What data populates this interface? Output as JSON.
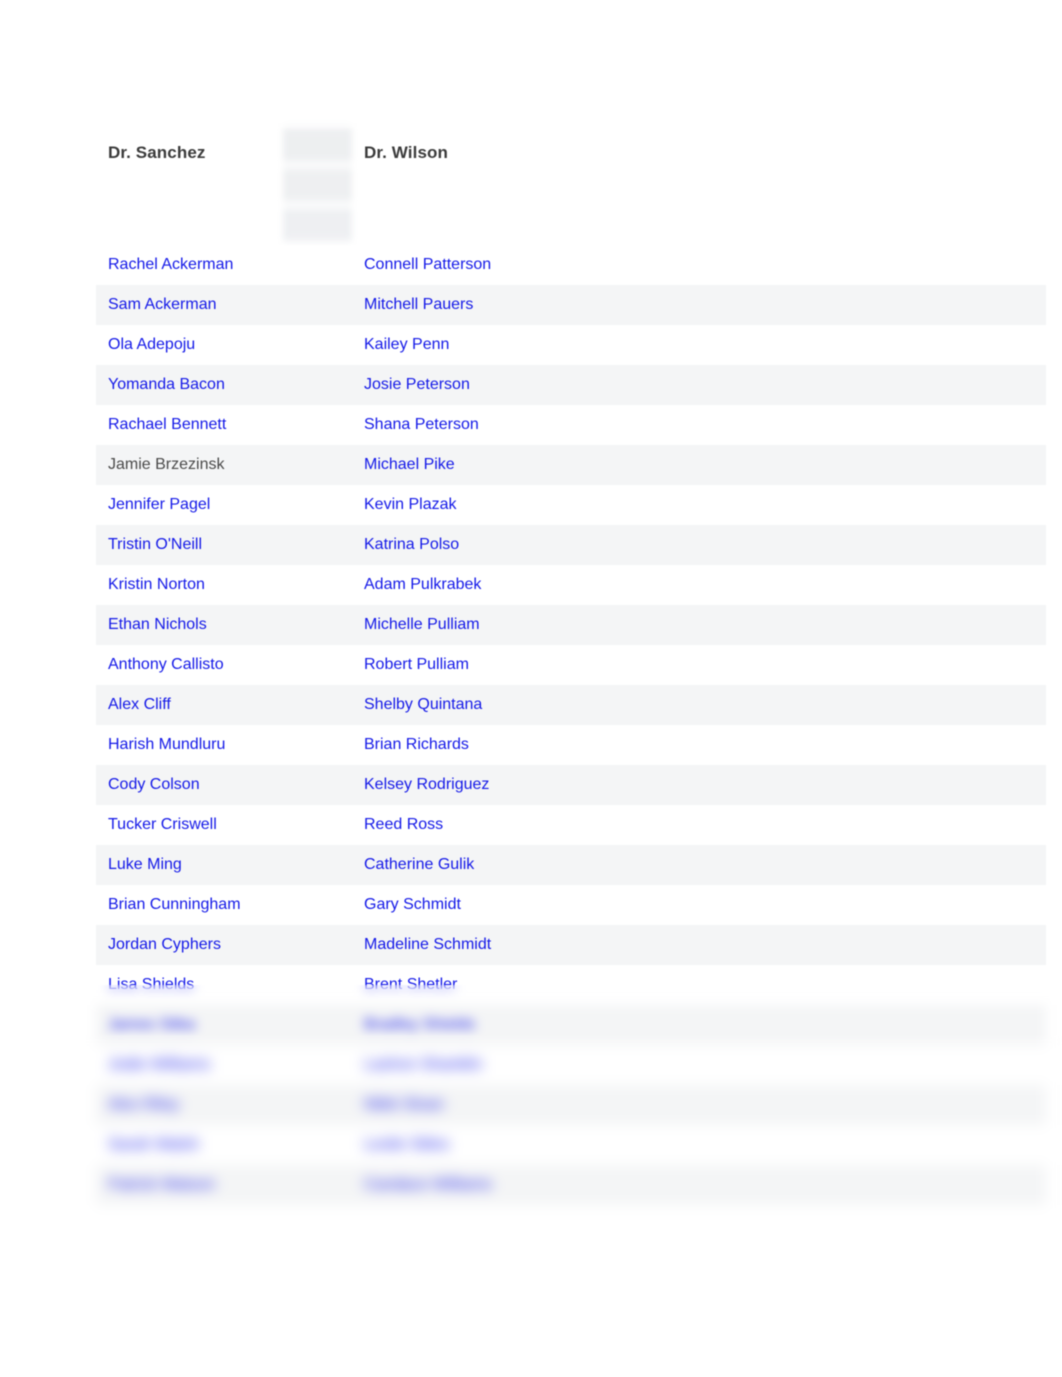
{
  "page": {
    "background_color": "#ffffff",
    "link_color": "#1419e8",
    "visited_link_color": "#4a4a4a",
    "header_text_color": "#3b3b3b",
    "stripe_color": "#f4f5f6"
  },
  "table": {
    "columns": [
      {
        "id": "col-sanchez",
        "header": "Dr. Sanchez"
      },
      {
        "id": "col-gap",
        "header": ""
      },
      {
        "id": "col-wilson",
        "header": "Dr. Wilson"
      },
      {
        "id": "col-rest",
        "header": ""
      }
    ],
    "rows": [
      {
        "sanchez": "Rachel Ackerman",
        "sanchez_state": "link",
        "wilson": "Connell Patterson",
        "wilson_state": "link",
        "blurred": false
      },
      {
        "sanchez": "Sam Ackerman",
        "sanchez_state": "link",
        "wilson": "Mitchell Pauers",
        "wilson_state": "link",
        "blurred": false
      },
      {
        "sanchez": "Ola Adepoju",
        "sanchez_state": "link",
        "wilson": "Kailey Penn",
        "wilson_state": "link",
        "blurred": false
      },
      {
        "sanchez": "Yomanda Bacon",
        "sanchez_state": "link",
        "wilson": "Josie Peterson",
        "wilson_state": "link",
        "blurred": false
      },
      {
        "sanchez": "Rachael Bennett",
        "sanchez_state": "link",
        "wilson": "Shana Peterson",
        "wilson_state": "link",
        "blurred": false
      },
      {
        "sanchez": "Jamie Brzezinsk",
        "sanchez_state": "visited",
        "wilson": "Michael Pike",
        "wilson_state": "link",
        "blurred": false
      },
      {
        "sanchez": "Jennifer Pagel",
        "sanchez_state": "link",
        "wilson": "Kevin Plazak",
        "wilson_state": "link",
        "blurred": false
      },
      {
        "sanchez": "Tristin O'Neill",
        "sanchez_state": "link",
        "wilson": "Katrina Polso",
        "wilson_state": "link",
        "blurred": false
      },
      {
        "sanchez": "Kristin Norton",
        "sanchez_state": "link",
        "wilson": "Adam Pulkrabek",
        "wilson_state": "link",
        "blurred": false
      },
      {
        "sanchez": "Ethan Nichols",
        "sanchez_state": "link",
        "wilson": "Michelle Pulliam",
        "wilson_state": "link",
        "blurred": false
      },
      {
        "sanchez": "Anthony Callisto",
        "sanchez_state": "link",
        "wilson": "Robert Pulliam",
        "wilson_state": "link",
        "blurred": false
      },
      {
        "sanchez": "Alex Cliff",
        "sanchez_state": "link",
        "wilson": "Shelby Quintana",
        "wilson_state": "link",
        "blurred": false
      },
      {
        "sanchez": "Harish Mundluru",
        "sanchez_state": "link",
        "wilson": "Brian Richards",
        "wilson_state": "link",
        "blurred": false
      },
      {
        "sanchez": "Cody Colson",
        "sanchez_state": "link",
        "wilson": "Kelsey Rodriguez",
        "wilson_state": "link",
        "blurred": false
      },
      {
        "sanchez": "Tucker Criswell",
        "sanchez_state": "link",
        "wilson": "Reed Ross",
        "wilson_state": "link",
        "blurred": false
      },
      {
        "sanchez": "Luke Ming",
        "sanchez_state": "link",
        "wilson": "Catherine Gulik",
        "wilson_state": "link",
        "blurred": false
      },
      {
        "sanchez": "Brian Cunningham",
        "sanchez_state": "link",
        "wilson": "Gary Schmidt",
        "wilson_state": "link",
        "blurred": false
      },
      {
        "sanchez": "Jordan Cyphers",
        "sanchez_state": "link",
        "wilson": "Madeline Schmidt",
        "wilson_state": "link",
        "blurred": false
      },
      {
        "sanchez": "Lisa Shields",
        "sanchez_state": "link",
        "wilson": "Brent Shetler",
        "wilson_state": "link",
        "blurred": true
      },
      {
        "sanchez": "James Sitka",
        "sanchez_state": "link",
        "wilson": "Bradley Shields",
        "wilson_state": "link",
        "blurred": true
      },
      {
        "sanchez": "Jodie Williams",
        "sanchez_state": "link",
        "wilson": "Lashon Shanklin",
        "wilson_state": "link",
        "blurred": true
      },
      {
        "sanchez": "Alex Riley",
        "sanchez_state": "link",
        "wilson": "Nikki Sloan",
        "wilson_state": "link",
        "blurred": true
      },
      {
        "sanchez": "Sarah Walsh",
        "sanchez_state": "link",
        "wilson": "Leslie Stiles",
        "wilson_state": "link",
        "blurred": true
      },
      {
        "sanchez": "Patrick Watson",
        "sanchez_state": "link",
        "wilson": "Candace Williams",
        "wilson_state": "link",
        "blurred": true
      }
    ]
  }
}
